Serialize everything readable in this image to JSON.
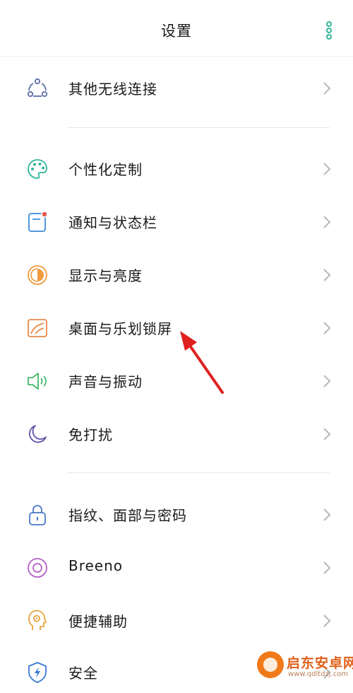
{
  "header": {
    "title": "设置",
    "more_icon": "more-vertical-icon",
    "accent_color": "#2fb69a"
  },
  "groups": [
    {
      "items": [
        {
          "label": "其他无线连接",
          "icon": "wireless-connection-icon",
          "color": "#5b6ea8"
        }
      ]
    },
    {
      "items": [
        {
          "label": "个性化定制",
          "icon": "palette-icon",
          "color": "#2fb69a"
        },
        {
          "label": "通知与状态栏",
          "icon": "notification-icon",
          "color": "#3a8fd9"
        },
        {
          "label": "显示与亮度",
          "icon": "brightness-icon",
          "color": "#f19a3e"
        },
        {
          "label": "桌面与乐划锁屏",
          "icon": "wallpaper-icon",
          "color": "#e8894a"
        },
        {
          "label": "声音与振动",
          "icon": "speaker-icon",
          "color": "#44b86c"
        },
        {
          "label": "免打扰",
          "icon": "moon-icon",
          "color": "#5b55a8"
        }
      ]
    },
    {
      "items": [
        {
          "label": "指纹、面部与密码",
          "icon": "lock-icon",
          "color": "#4a78c7"
        },
        {
          "label": "Breeno",
          "icon": "breeno-icon",
          "color": "#b45fc6"
        },
        {
          "label": "便捷辅助",
          "icon": "assist-icon",
          "color": "#e8a33a"
        },
        {
          "label": "安全",
          "icon": "shield-icon",
          "color": "#3a79d6"
        }
      ]
    }
  ],
  "annotation": {
    "arrow_color": "#e02020"
  },
  "watermark": {
    "name": "启东安卓网",
    "url": "www.qdltdzj.com"
  }
}
